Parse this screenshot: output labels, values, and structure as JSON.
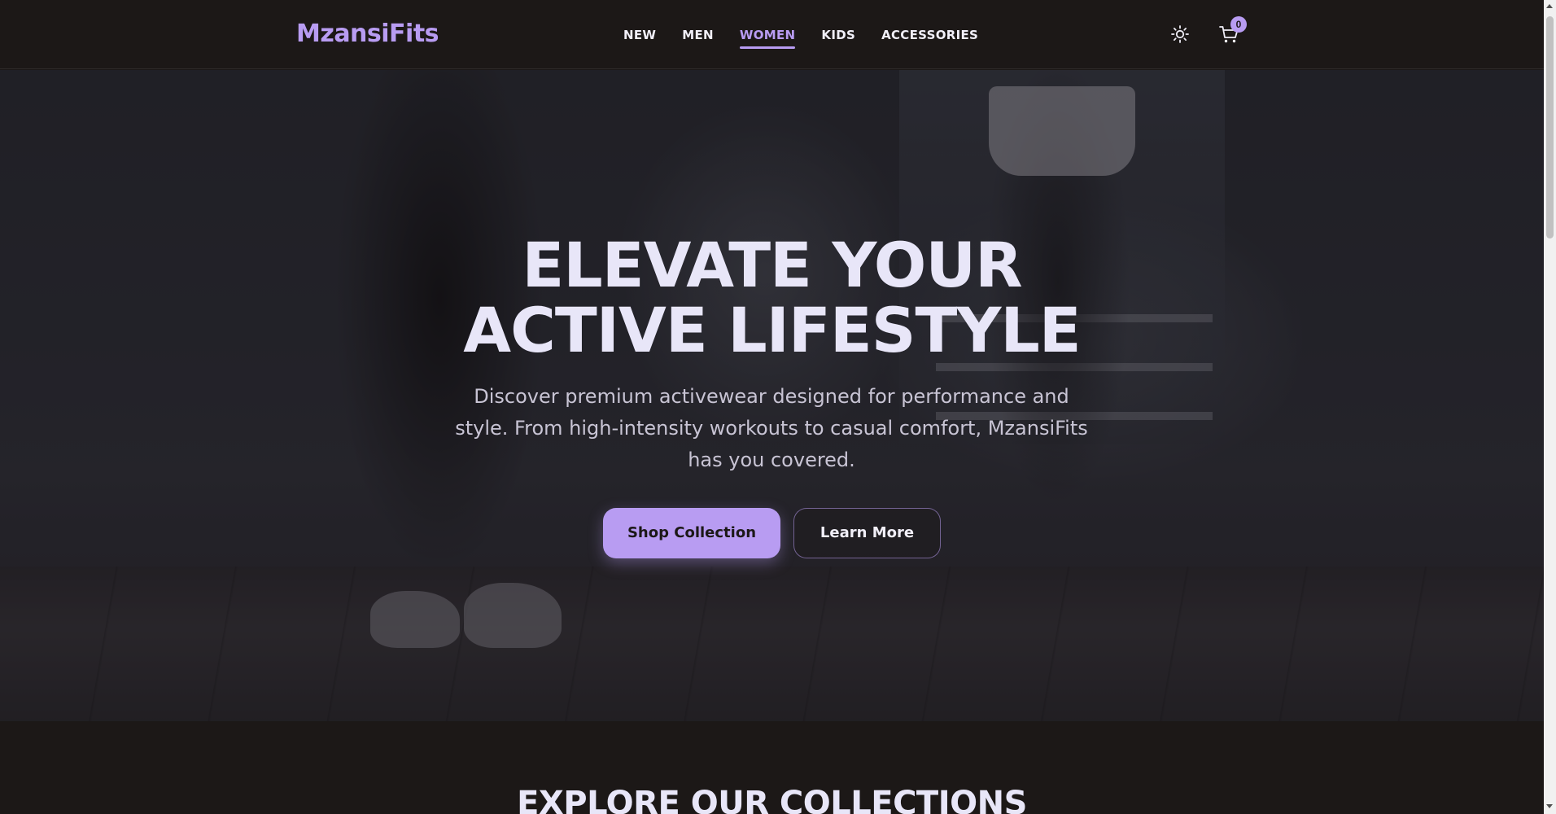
{
  "header": {
    "logo": "MzansiFits",
    "nav": [
      {
        "label": "NEW",
        "active": false
      },
      {
        "label": "MEN",
        "active": false
      },
      {
        "label": "WOMEN",
        "active": true
      },
      {
        "label": "KIDS",
        "active": false
      },
      {
        "label": "ACCESSORIES",
        "active": false
      }
    ],
    "theme_icon": "sun-icon",
    "cart_icon": "cart-icon",
    "cart_count": "0"
  },
  "hero": {
    "title_line1": "ELEVATE YOUR",
    "title_line2": "ACTIVE LIFESTYLE",
    "subtitle": "Discover premium activewear designed for performance and style. From high-intensity workouts to casual comfort, MzansiFits has you covered.",
    "primary_button": "Shop Collection",
    "secondary_button": "Learn More"
  },
  "collections": {
    "title": "EXPLORE OUR COLLECTIONS"
  },
  "colors": {
    "accent": "#b89cf2",
    "background": "#1c1817",
    "text": "#e8e6f8"
  }
}
